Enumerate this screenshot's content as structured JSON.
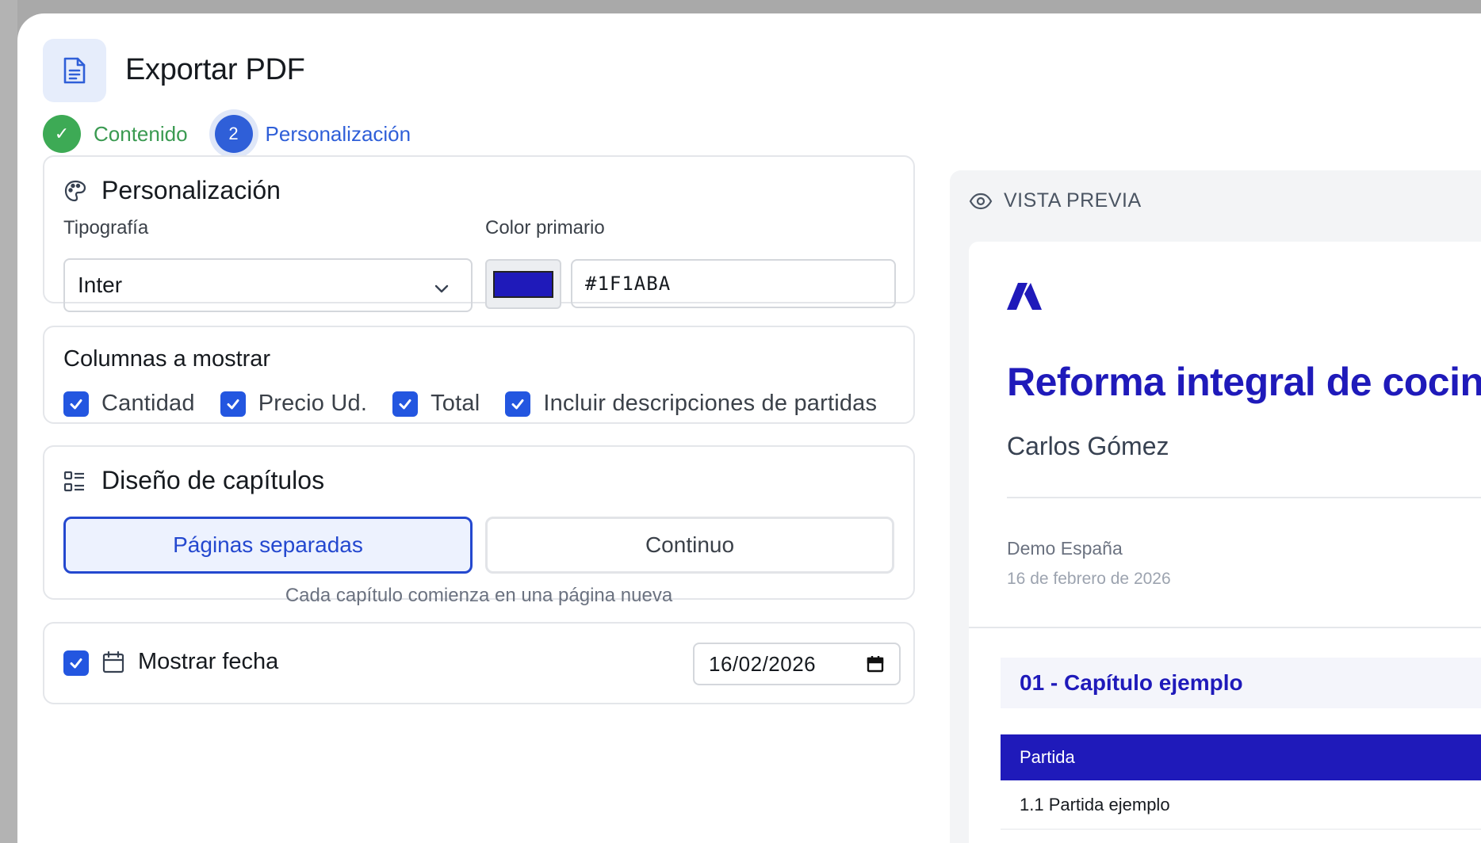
{
  "header": {
    "title": "Exportar PDF",
    "icon": "document-icon"
  },
  "stepper": {
    "steps": [
      {
        "label": "Contenido",
        "status": "done",
        "marker": "✓"
      },
      {
        "label": "Personalización",
        "status": "active",
        "marker": "2"
      }
    ]
  },
  "personalizacion": {
    "title": "Personalización",
    "icon": "palette-icon",
    "typography_label": "Tipografía",
    "typography_value": "Inter",
    "color_label": "Color primario",
    "color_value": "#1F1ABA"
  },
  "columns": {
    "title": "Columnas a mostrar",
    "items": [
      {
        "label": "Cantidad",
        "checked": true
      },
      {
        "label": "Precio Ud.",
        "checked": true
      },
      {
        "label": "Total",
        "checked": true
      },
      {
        "label": "Incluir descripciones de partidas",
        "checked": true
      }
    ]
  },
  "chapters": {
    "title": "Diseño de capítulos",
    "icon": "layout-list-icon",
    "option_separate": "Páginas separadas",
    "option_continuous": "Continuo",
    "selected": "Páginas separadas",
    "hint": "Cada capítulo comienza en una página nueva"
  },
  "date_row": {
    "checked": true,
    "label": "Mostrar fecha",
    "value": "16/02/2026"
  },
  "preview": {
    "heading": "VISTA PREVIA",
    "doc_title": "Reforma integral de cocina",
    "client": "Carlos Gómez",
    "company": "Demo España",
    "date": "16 de febrero de 2026",
    "chapter": "01 - Capítulo ejemplo",
    "table_header": "Partida",
    "table_row": "1.1 Partida ejemplo"
  },
  "colors": {
    "primary": "#1F1ABA",
    "accent": "#2F5FD8",
    "success": "#3DAA55",
    "checkbox": "#2356E0"
  }
}
